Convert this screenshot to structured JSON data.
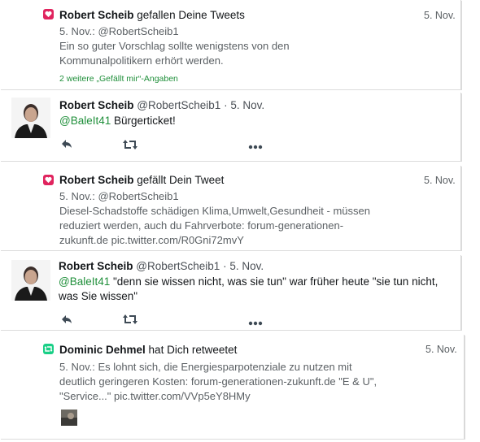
{
  "notifications": [
    {
      "type": "like",
      "actor": "Robert Scheib",
      "action_text": "gefallen Deine Tweets",
      "date": "5. Nov.",
      "quoted_meta": "5. Nov.: @RobertScheib1",
      "quoted_text_1": "Ein so guter Vorschlag sollte wenigstens von den",
      "quoted_text_2": "Kommunalpolitikern erhört werden.",
      "extra": "2 weitere „Gefällt mir“-Angaben"
    },
    {
      "type": "tweet",
      "author": "Robert Scheib",
      "handle": "@RobertScheib1",
      "separator": "·",
      "date": "5. Nov.",
      "mention": "@BaleIt41",
      "text": " Bürgerticket!"
    },
    {
      "type": "like",
      "actor": "Robert Scheib",
      "action_text": "gefällt Dein Tweet",
      "date": "5. Nov.",
      "quoted_meta": "5. Nov.: @RobertScheib1",
      "quoted_text_1": "Diesel-Schadstoffe schädigen Klima,Umwelt,Gesundheit - müssen",
      "quoted_text_2": "reduziert werden, auch du Fahrverbote: forum-generationen-",
      "quoted_text_3": "zukunft.de pic.twitter.com/R0Gni72mvY"
    },
    {
      "type": "tweet",
      "author": "Robert Scheib",
      "handle": "@RobertScheib1",
      "separator": "·",
      "date": "5. Nov.",
      "mention": "@BaleIt41",
      "text_1": " \"denn sie wissen nicht, was sie tun\" war früher heute \"sie tun nicht,",
      "text_2": "was Sie wissen\""
    },
    {
      "type": "retweet",
      "actor": "Dominic Dehmel",
      "action_text": "hat Dich retweetet",
      "date": "5. Nov.",
      "quoted_meta_text_1": "5. Nov.: Es lohnt sich, die Energiesparpotenziale zu nutzen mit",
      "quoted_text_2": "deutlich geringeren Kosten: forum-generationen-zukunft.de \"E & U\",",
      "quoted_text_3": "\"Service...\" pic.twitter.com/VVp5eY8HMy"
    }
  ],
  "colors": {
    "like": "#e0245e",
    "retweet": "#19cf86",
    "link": "#1f8f3a"
  },
  "icons": [
    "heart-icon",
    "retweet-icon",
    "reply-icon",
    "more-icon",
    "avatar"
  ]
}
